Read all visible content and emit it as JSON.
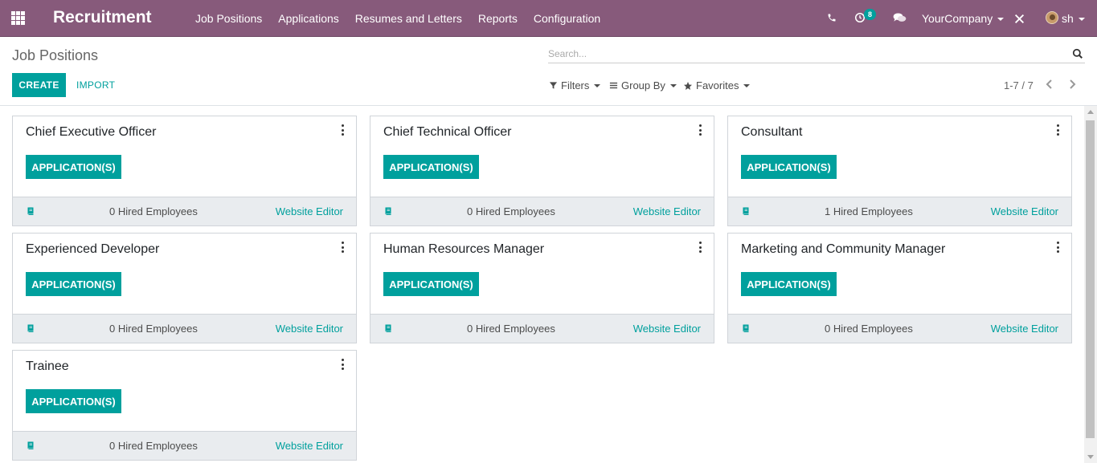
{
  "navbar": {
    "brand": "Recruitment",
    "menu": [
      "Job Positions",
      "Applications",
      "Resumes and Letters",
      "Reports",
      "Configuration"
    ],
    "activity_count": "8",
    "company": "YourCompany",
    "user": "sh",
    "icons": [
      "apps-grid-icon",
      "phone-icon",
      "activity-clock-icon",
      "chat-icon",
      "debug-tools-icon",
      "avatar"
    ]
  },
  "control_panel": {
    "breadcrumb": "Job Positions",
    "create_label": "CREATE",
    "import_label": "IMPORT",
    "search_placeholder": "Search...",
    "filters_label": "Filters",
    "group_by_label": "Group By",
    "favorites_label": "Favorites",
    "pager": "1-7 / 7"
  },
  "cards": [
    {
      "title": "Chief Executive Officer",
      "button": "APPLICATION(S)",
      "hired": "0 Hired Employees",
      "link": "Website Editor"
    },
    {
      "title": "Chief Technical Officer",
      "button": "APPLICATION(S)",
      "hired": "0 Hired Employees",
      "link": "Website Editor"
    },
    {
      "title": "Consultant",
      "button": "APPLICATION(S)",
      "hired": "1 Hired Employees",
      "link": "Website Editor"
    },
    {
      "title": "Experienced Developer",
      "button": "APPLICATION(S)",
      "hired": "0 Hired Employees",
      "link": "Website Editor"
    },
    {
      "title": "Human Resources Manager",
      "button": "APPLICATION(S)",
      "hired": "0 Hired Employees",
      "link": "Website Editor"
    },
    {
      "title": "Marketing and Community Manager",
      "button": "APPLICATION(S)",
      "hired": "0 Hired Employees",
      "link": "Website Editor"
    },
    {
      "title": "Trainee",
      "button": "APPLICATION(S)",
      "hired": "0 Hired Employees",
      "link": "Website Editor"
    }
  ],
  "colors": {
    "navbar": "#875a7b",
    "primary": "#00a09d",
    "card_footer": "#e9ecef"
  }
}
